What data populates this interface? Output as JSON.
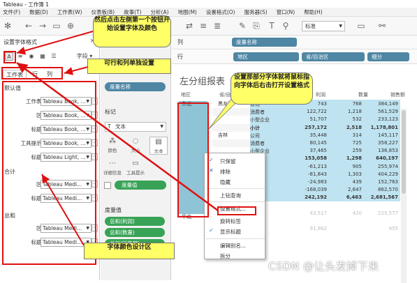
{
  "window": {
    "title": "Tableau - 工作簿 1"
  },
  "menu": [
    "文件(F)",
    "数据(D)",
    "工作表(W)",
    "仪表板(B)",
    "故事(T)",
    "分析(A)",
    "地图(M)",
    "设置格式(O)",
    "服务器(S)",
    "窗口(N)",
    "帮助(H)"
  ],
  "toolbar": {
    "fit": "标准"
  },
  "format_pane": {
    "title": "设置字体格式",
    "close": "×",
    "fields": "字段 ▾",
    "tabs": [
      "工作表",
      "行",
      "列"
    ],
    "default_group": "默认值",
    "total_group": "合计",
    "grand_total_group": "总和",
    "default_rows": [
      {
        "label": "工作表:",
        "value": "Tableau Book, ..."
      },
      {
        "label": "区:",
        "value": "Tableau Book, ..."
      },
      {
        "label": "标题:",
        "value": "Tableau Book, ..."
      },
      {
        "label": "工具提示:",
        "value": "Tableau Book, ..."
      },
      {
        "label": "标题:",
        "value": "Tableau Light, ..."
      }
    ],
    "total_rows": [
      {
        "label": "区:",
        "value": "Tableau Medi..."
      },
      {
        "label": "标题:",
        "value": "Tableau Medi..."
      }
    ],
    "grand_total_rows": [
      {
        "label": "区:",
        "value": "Tableau Medi..."
      },
      {
        "label": "标题:",
        "value": "Tableau Medi..."
      }
    ]
  },
  "middle": {
    "measure_names_pill": "度量名称",
    "marks_title": "标记",
    "mark_type": "文本",
    "marks_buttons": [
      "颜色",
      "大小",
      "文本",
      "详细信息",
      "工具提示"
    ],
    "marks_pill": "度量值",
    "measure_values_title": "度量值",
    "measure_pills": [
      "总和(利润)",
      "总和(数量)",
      "总和(销售额)"
    ]
  },
  "view": {
    "columns_label": "列",
    "rows_label": "行",
    "column_pill": "度量名称",
    "row_pills": [
      "地区",
      "省/自治区",
      "细分"
    ],
    "title": "左分组报表",
    "headers": [
      "地区",
      "省/自治",
      "",
      "利润",
      "数量",
      "销售额"
    ],
    "region_1": "东北",
    "region_2": "华北",
    "province_1": "黑龙江",
    "province_2": "吉林",
    "rows": [
      {
        "seg": "公司",
        "p": "743",
        "q": "768",
        "s": "384,149"
      },
      {
        "seg": "消费者",
        "p": "122,722",
        "q": "1,218",
        "s": "561,529"
      },
      {
        "seg": "小型企业",
        "p": "51,707",
        "q": "532",
        "s": "233,123"
      },
      {
        "seg": "小计",
        "p": "257,172",
        "q": "2,518",
        "s": "1,178,801"
      },
      {
        "seg": "公司",
        "p": "35,448",
        "q": "314",
        "s": "145,117"
      },
      {
        "seg": "消费者",
        "p": "80,145",
        "q": "725",
        "s": "358,227"
      },
      {
        "seg": "小型企业",
        "p": "37,465",
        "q": "259",
        "s": "136,853"
      },
      {
        "seg": "小计",
        "p": "153,058",
        "q": "1,298",
        "s": "640,197"
      },
      {
        "seg": "",
        "p": "-61,213",
        "q": "905",
        "s": "255,974"
      },
      {
        "seg": "",
        "p": "-81,843",
        "q": "1,303",
        "s": "404,229"
      },
      {
        "seg": "",
        "p": "-24,983",
        "q": "439",
        "s": "152,763"
      },
      {
        "seg": "",
        "p": "-168,039",
        "q": "2,647",
        "s": "862,570"
      },
      {
        "seg": "",
        "p": "242,192",
        "q": "6,463",
        "s": "2,681,567"
      },
      {
        "seg": "",
        "p": "",
        "q": "",
        "s": ""
      },
      {
        "seg": "",
        "p": "43,517",
        "q": "420",
        "s": "225,577"
      },
      {
        "seg": "",
        "p": "",
        "q": "",
        "s": ""
      },
      {
        "seg": "",
        "p": "91,962",
        "q": "",
        "s": "955"
      },
      {
        "seg": "",
        "p": "",
        "q": "",
        "s": ""
      }
    ]
  },
  "context_menu": [
    "只保留",
    "排除",
    "隐藏",
    "上钻查询",
    "设置格式...",
    "旋转标签",
    "显示标题",
    "编辑别名...",
    "拆分"
  ],
  "callouts": {
    "c1": "然后点击左侧第一个按钮开始设置字体及颜色",
    "c2": "可行和列单独设置",
    "c3": "设置那部分字体就将鼠标指向字体后右击打开设置格式",
    "c4": "字体颜色设计区"
  },
  "watermark": "CSDN @让头发掉下来",
  "colors": {
    "highlight": "#bfe3f0",
    "region_highlight": "#8fc3d6",
    "pill_blue": "#4e86a4",
    "pill_green": "#38a356",
    "annotation_red": "#e01010",
    "callout_yellow": "#ffff66"
  }
}
